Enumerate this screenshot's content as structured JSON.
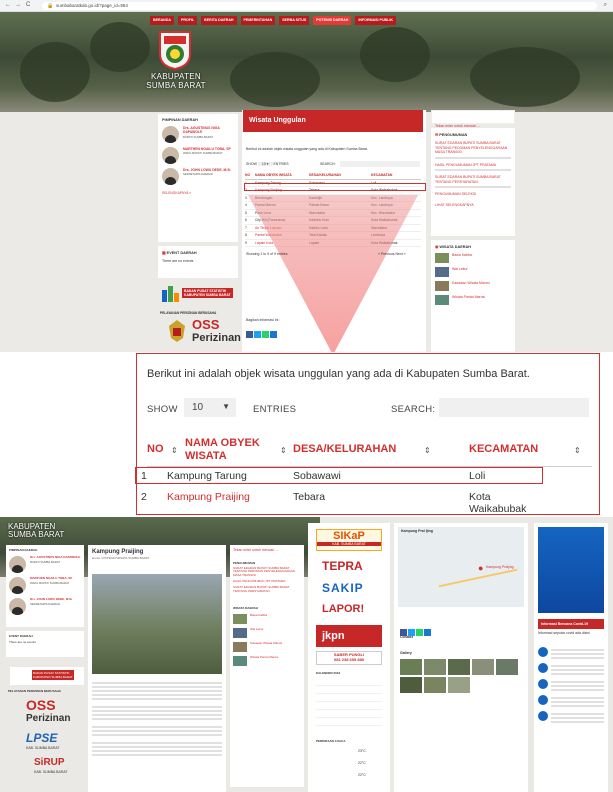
{
  "browser": {
    "url": "sumbabaratkab.go.id/?page_id=954",
    "back": "←",
    "forward": "→",
    "reload": "C"
  },
  "top": {
    "nav": [
      "BERANDA",
      "PROFIL",
      "BERITA DAERAH",
      "PEMERINTAHAN",
      "SERBA SITUS",
      "POTENSI DAERAH",
      "INFORMASI PUBLIK"
    ],
    "site_title_line1": "KABUPATEN",
    "site_title_line2": "SUMBA BARAT",
    "leaders_title": "PIMPINAN DAERAH",
    "leaders": [
      {
        "name": "Drs. AGUSTINUS NIGA DAPAWOLE",
        "role": "BUPATI SUMBA BARAT"
      },
      {
        "name": "MARTHEN NGAILU TOBA, SP",
        "role": "WAKIL BUPATI SUMBA BARAT"
      },
      {
        "name": "Drs. JOHN LOWU DEDE, M.Si",
        "role": "SEKRETARIS DAERAH"
      }
    ],
    "leaders_more": "SELENGKAPNYA »",
    "event_title": "EVENT DAERAH",
    "event_text": "There are no events",
    "bps_line1": "BADAN PUSAT STATISTIK",
    "bps_line2": "KABUPATEN SUMBA BARAT",
    "service_title": "PELAYANAN PERIZINAN BERUSAHA",
    "oss_label": "OSS",
    "perizinan_label": "Perizinan",
    "page_heading": "Wisata Unggulan",
    "intro": "Berikut ini adalah objek wisata unggulan yang ada di Kabupaten Sumba Barat.",
    "table_headers": [
      "NO",
      "NAMA OBYEK WISATA",
      "DESA/KELURAHAN",
      "KECAMATAN"
    ],
    "rows": [
      [
        "1",
        "Kampung Tarung",
        "Sobawawi",
        "Loli"
      ],
      [
        "2",
        "Kampung Praijing",
        "Tebara",
        "Kota Waikabubak"
      ],
      [
        "3",
        "Bendungan",
        "Kadirdjik",
        "Kec. Lamboya"
      ],
      [
        "4",
        "Pantai Marosi",
        "Patiala Bawa",
        "Kec. Lamboya"
      ],
      [
        "5",
        "Pasir Lima",
        "Wanokaka",
        "Kec. Wanokaka"
      ],
      [
        "6",
        "City Hill (Panorama)",
        "Kalimbu Kuni",
        "Kota Waikabubak"
      ],
      [
        "7",
        "Air Terjun Lapopu",
        "Kalebu Ledu",
        "Wanukaka"
      ],
      [
        "8",
        "Pantai Wanokaka",
        "Tara Kabalu",
        "Lamboya"
      ],
      [
        "9",
        "Lapale Kota",
        "Lapale",
        "Kota Waikabubak"
      ]
    ],
    "showing": "Showing 1 to 9 of 9 entries",
    "pagination": "« Previous  Next »",
    "share_label": "Bagikan informasi ini :",
    "search_placeholder": "Tekan enter untuk mencari ...",
    "announce_title": "PENGUMUMAN",
    "announcements": [
      "SURAT EDARAN BUPATI SUMBA BARAT TENTANG PEDOMAN PENYELENGGARAAN MASA TRANSISI",
      "HASIL PENGUMUMAN JPT PRATAMA",
      "SURAT EDARAN BUPATI SUMBA BARAT TENTANG PERSYARATAN",
      "PENGUMUMAN SELEKSI"
    ],
    "announce_more": "LIHAT SELENGKAPNYA",
    "wisata_side_title": "WISATA DAERAH",
    "wisata_side": [
      "Bawa Kabba",
      "Wai Lekur",
      "Kawasan Wisata Marosi",
      "Wisata Pantai Marosi"
    ]
  },
  "zoom": {
    "intro": "Berikut ini adalah objek wisata unggulan yang ada di Kabupaten Sumba Barat.",
    "show": "SHOW",
    "entries_value": "10",
    "entries": "ENTRIES",
    "search_label": "SEARCH:",
    "headers": {
      "no": "NO",
      "nama_line1": "NAMA OBYEK",
      "nama_line2": "WISATA",
      "desa": "DESA/KELURAHAN",
      "kecamatan": "KECAMATAN"
    },
    "row1": {
      "no": "1",
      "nama": "Kampung Tarung",
      "desa": "Sobawawi",
      "kec": "Loli"
    },
    "row2": {
      "no": "2",
      "nama": "Kampung Praijing",
      "desa": "Tebara",
      "kec_line1": "Kota",
      "kec_line2": "Waikabubak"
    }
  },
  "bottom": {
    "site_title_line1": "KABUPATEN",
    "site_title_line2": "SUMBA BARAT",
    "heading": "Kampung Praijing",
    "breadcrumb": "Home  /  POTENSI WISATA SUMBA BARAT",
    "sikap": "SIKaP",
    "sikap_sub": "KAB. SUMBA BARAT",
    "tepra": "TEPRA",
    "sakip": "SAKIP",
    "lapor": "LAPOR!",
    "jkpn": "jkpn",
    "saber": "SABER PUNGLI",
    "saber_phone": "081 238 695 880",
    "lpse": "LPSE",
    "lpse_sub": "KAB. SUMBA BARAT",
    "sirup": "SiRUP",
    "sirup_sub": "KAB. SUMBA BARAT",
    "oss": "OSS",
    "perizinan": "Perizinan",
    "calendar_title": "KALENDER 2019",
    "weather_title": "PERKIRAAN CUACA",
    "temps": [
      "23°C",
      "22°C",
      "22°C"
    ],
    "map_place": "Kampung Prai Ijing",
    "map_marker_label": "Kampung Praijing",
    "contact_label": "Contact",
    "gallery_label": "Gallery",
    "news_title": "Informasi Bencana Covid-19",
    "hotline": "Informasi seputar covid ada disini"
  },
  "colors": {
    "brand_red": "#c62828",
    "accent_red": "#d32f2f"
  }
}
